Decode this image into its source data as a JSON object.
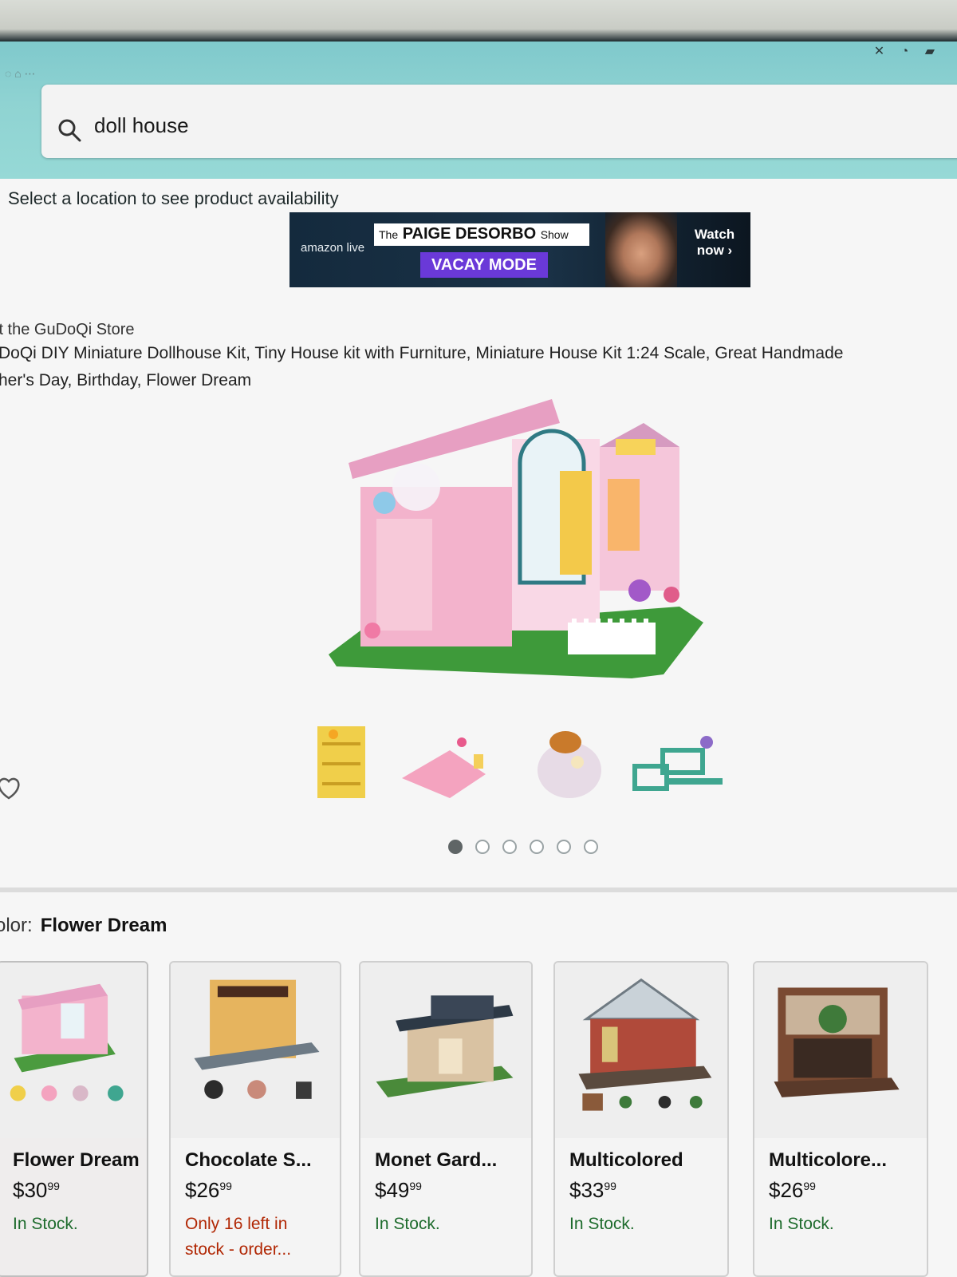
{
  "search": {
    "query": "doll house"
  },
  "location_prompt": "Select a location to see product availability",
  "banner": {
    "brand": "amazon live",
    "show_prefix": "The",
    "show_name": "PAIGE DESORBO",
    "show_suffix": "Show",
    "subtitle": "VACAY MODE",
    "cta_line1": "Watch",
    "cta_line2": "now ›"
  },
  "product": {
    "store_link": "it the GuDoQi Store",
    "title_line1": "DoQi DIY Miniature Dollhouse Kit, Tiny House kit with Furniture, Miniature House Kit 1:24 Scale, Great Handmade",
    "title_line2": "her's Day, Birthday, Flower Dream",
    "image_count": 6,
    "current_image": 1
  },
  "color": {
    "label": "olor:",
    "selected": "Flower Dream"
  },
  "colors": {
    "accent_teal": "#8fd3d2",
    "stock_green": "#1d6b2c",
    "low_stock_red": "#b12704"
  },
  "variants": [
    {
      "name": "Flower Dream",
      "price_whole": "$30",
      "price_frac": "99",
      "stock": "In Stock."
    },
    {
      "name": "Chocolate S...",
      "price_whole": "$26",
      "price_frac": "99",
      "stock_line1": "Only 16 left in",
      "stock_line2": "stock - order..."
    },
    {
      "name": "Monet Gard...",
      "price_whole": "$49",
      "price_frac": "99",
      "stock": "In Stock."
    },
    {
      "name": "Multicolored",
      "price_whole": "$33",
      "price_frac": "99",
      "stock": "In Stock."
    },
    {
      "name": "Multicolore...",
      "price_whole": "$26",
      "price_frac": "99",
      "stock": "In Stock."
    }
  ]
}
